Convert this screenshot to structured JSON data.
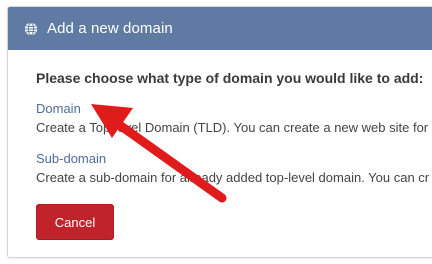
{
  "dialog": {
    "title": "Add a new domain",
    "icon": "globe-icon",
    "header_color": "#5f7ba3",
    "question": "Please choose what type of domain you would like to add:",
    "options": [
      {
        "label": "Domain",
        "description": "Create a Top-level Domain (TLD). You can create a new web site for"
      },
      {
        "label": "Sub-domain",
        "description": "Create a sub-domain for already added top-level domain. You can cr"
      }
    ],
    "cancel_label": "Cancel",
    "cancel_color": "#c0232a"
  },
  "annotation": {
    "type": "red-arrow",
    "color": "#e01b1b",
    "points_to": "Domain link"
  }
}
